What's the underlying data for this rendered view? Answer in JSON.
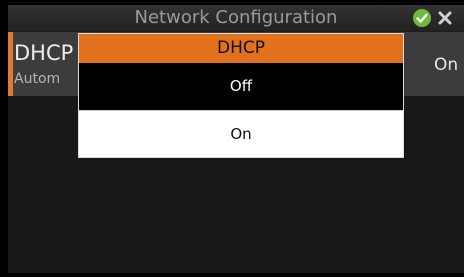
{
  "titlebar": {
    "title": "Network Configuration",
    "confirm_icon": "check-circle-icon",
    "close_icon": "close-icon"
  },
  "setting": {
    "name": "DHCP",
    "subtitle": "Autom",
    "value": "On",
    "accent_color": "#e07a2e"
  },
  "dialog": {
    "title": "DHCP",
    "header_color": "#e2711e",
    "options": [
      {
        "label": "Off",
        "selected": true
      },
      {
        "label": "On",
        "selected": false
      }
    ]
  }
}
